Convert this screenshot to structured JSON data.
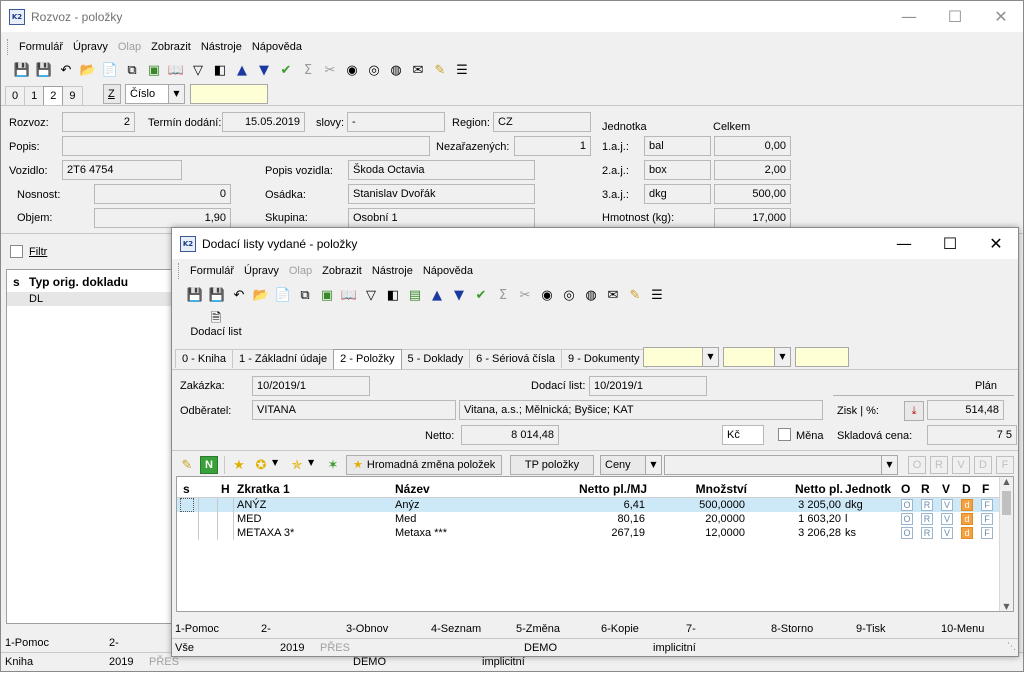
{
  "bg_window": {
    "title": "Rozvoz - položky",
    "menu": [
      "Formulář",
      "Úpravy",
      "Olap",
      "Zobrazit",
      "Nástroje",
      "Nápověda"
    ],
    "menu_disabled": [
      false,
      false,
      true,
      false,
      false,
      false
    ],
    "tabs": [
      "0",
      "1",
      "2",
      "9"
    ],
    "active_tab": 2,
    "sort_key": "Z",
    "sort_select": "Číslo",
    "fields": {
      "rozvoz_label": "Rozvoz:",
      "rozvoz": "2",
      "termin_label": "Termín dodání:",
      "termin": "15.05.2019",
      "slovy_label": "slovy:",
      "slovy": "-",
      "region_label": "Region:",
      "region": "CZ",
      "popis_label": "Popis:",
      "nezarazenych_label": "Nezařazených:",
      "nezarazenych": "1",
      "vozidlo_label": "Vozidlo:",
      "vozidlo": "2T6 4754",
      "popis_vozidla_label": "Popis vozidla:",
      "popis_vozidla": "Škoda Octavia",
      "nosnost_label": "Nosnost:",
      "nosnost": "0",
      "osadka_label": "Osádka:",
      "osadka": "Stanislav Dvořák",
      "objem_label": "Objem:",
      "objem": "1,90",
      "skupina_label": "Skupina:",
      "skupina": "Osobní 1",
      "jednotka_label": "Jednotka",
      "celkem_label": "Celkem",
      "aj1_label": "1.a.j.:",
      "aj1_unit": "bal",
      "aj1_total": "0,00",
      "aj2_label": "2.a.j.:",
      "aj2_unit": "box",
      "aj2_total": "2,00",
      "aj3_label": "3.a.j.:",
      "aj3_unit": "dkg",
      "aj3_total": "500,00",
      "hmotnost_label": "Hmotnost (kg):",
      "hmotnost": "17,000"
    },
    "filter_label": "Filtr",
    "grid_headers": {
      "s": "s",
      "typ": "Typ orig. dokladu"
    },
    "grid_rows": [
      {
        "typ": "DL"
      }
    ],
    "fkeys": [
      "1-Pomoc",
      "2-"
    ],
    "status": [
      "Kniha",
      "2019",
      "PŘES",
      "DEMO",
      "implicitní"
    ]
  },
  "fg_window": {
    "title": "Dodací listy vydané - položky",
    "menu": [
      "Formulář",
      "Úpravy",
      "Olap",
      "Zobrazit",
      "Nástroje",
      "Nápověda"
    ],
    "menu_disabled": [
      false,
      false,
      true,
      false,
      false,
      false
    ],
    "doc_button": "Dodací list",
    "tabs": [
      "0 - Kniha",
      "1 - Základní údaje",
      "2 - Položky",
      "5 - Doklady",
      "6 - Sériová čísla",
      "9 - Dokumenty"
    ],
    "active_tab": 2,
    "fields": {
      "zakazka_label": "Zakázka:",
      "zakazka": "10/2019/1",
      "dodaci_list_label": "Dodací list:",
      "dodaci_list": "10/2019/1",
      "plan_label": "Plán",
      "odberatel_label": "Odběratel:",
      "odberatel": "VITANA",
      "odberatel_adresa": "Vitana, a.s.; Mělnická; Byšice; KAT",
      "zisk_label": "Zisk | %:",
      "zisk": "514,48",
      "netto_label": "Netto:",
      "netto": "8 014,48",
      "mena_code": "Kč",
      "mena_label": "Měna",
      "skladova_cena_label": "Skladová cena:",
      "skladova_cena": "7 5"
    },
    "grid_toolbar": {
      "n_label": "N",
      "hromadna": "Hromadná změna položek",
      "tp_polozky": "TP položky",
      "ceny": "Ceny",
      "flags": [
        "O",
        "R",
        "V",
        "D",
        "F"
      ]
    },
    "grid_headers": {
      "s": "s",
      "h": "H",
      "zkratka": "Zkratka 1",
      "nazev": "Název",
      "netto_mj": "Netto pl./MJ",
      "mnozstvi": "Množství",
      "netto_pl": "Netto pl.",
      "jednotka": "Jednotk",
      "o": "O",
      "r": "R",
      "v": "V",
      "d": "D",
      "f": "F"
    },
    "grid_rows": [
      {
        "zkratka": "ANÝZ",
        "nazev": "Anýz",
        "netto_mj": "6,41",
        "mnozstvi": "500,0000",
        "netto_pl": "3 205,00",
        "jednotka": "dkg",
        "o": "O",
        "r": "R",
        "v": "V",
        "d": "d",
        "f": "F"
      },
      {
        "zkratka": "MED",
        "nazev": "Med",
        "netto_mj": "80,16",
        "mnozstvi": "20,0000",
        "netto_pl": "1 603,20",
        "jednotka": "l",
        "o": "O",
        "r": "R",
        "v": "V",
        "d": "d",
        "f": "F"
      },
      {
        "zkratka": "METAXA 3*",
        "nazev": "Metaxa ***",
        "netto_mj": "267,19",
        "mnozstvi": "12,0000",
        "netto_pl": "3 206,28",
        "jednotka": "ks",
        "o": "O",
        "r": "R",
        "v": "V",
        "d": "d",
        "f": "F"
      }
    ],
    "fkeys": [
      "1-Pomoc",
      "2-",
      "3-Obnov",
      "4-Seznam",
      "5-Změna",
      "6-Kopie",
      "7-",
      "8-Storno",
      "9-Tisk",
      "10-Menu"
    ],
    "status": [
      "Vše",
      "2019",
      "PŘES",
      "DEMO",
      "implicitní"
    ]
  },
  "colors": {
    "selected_row": "#cde8f6",
    "yellow_field": "#ffffd5",
    "flag_orange": "#f5a142"
  }
}
